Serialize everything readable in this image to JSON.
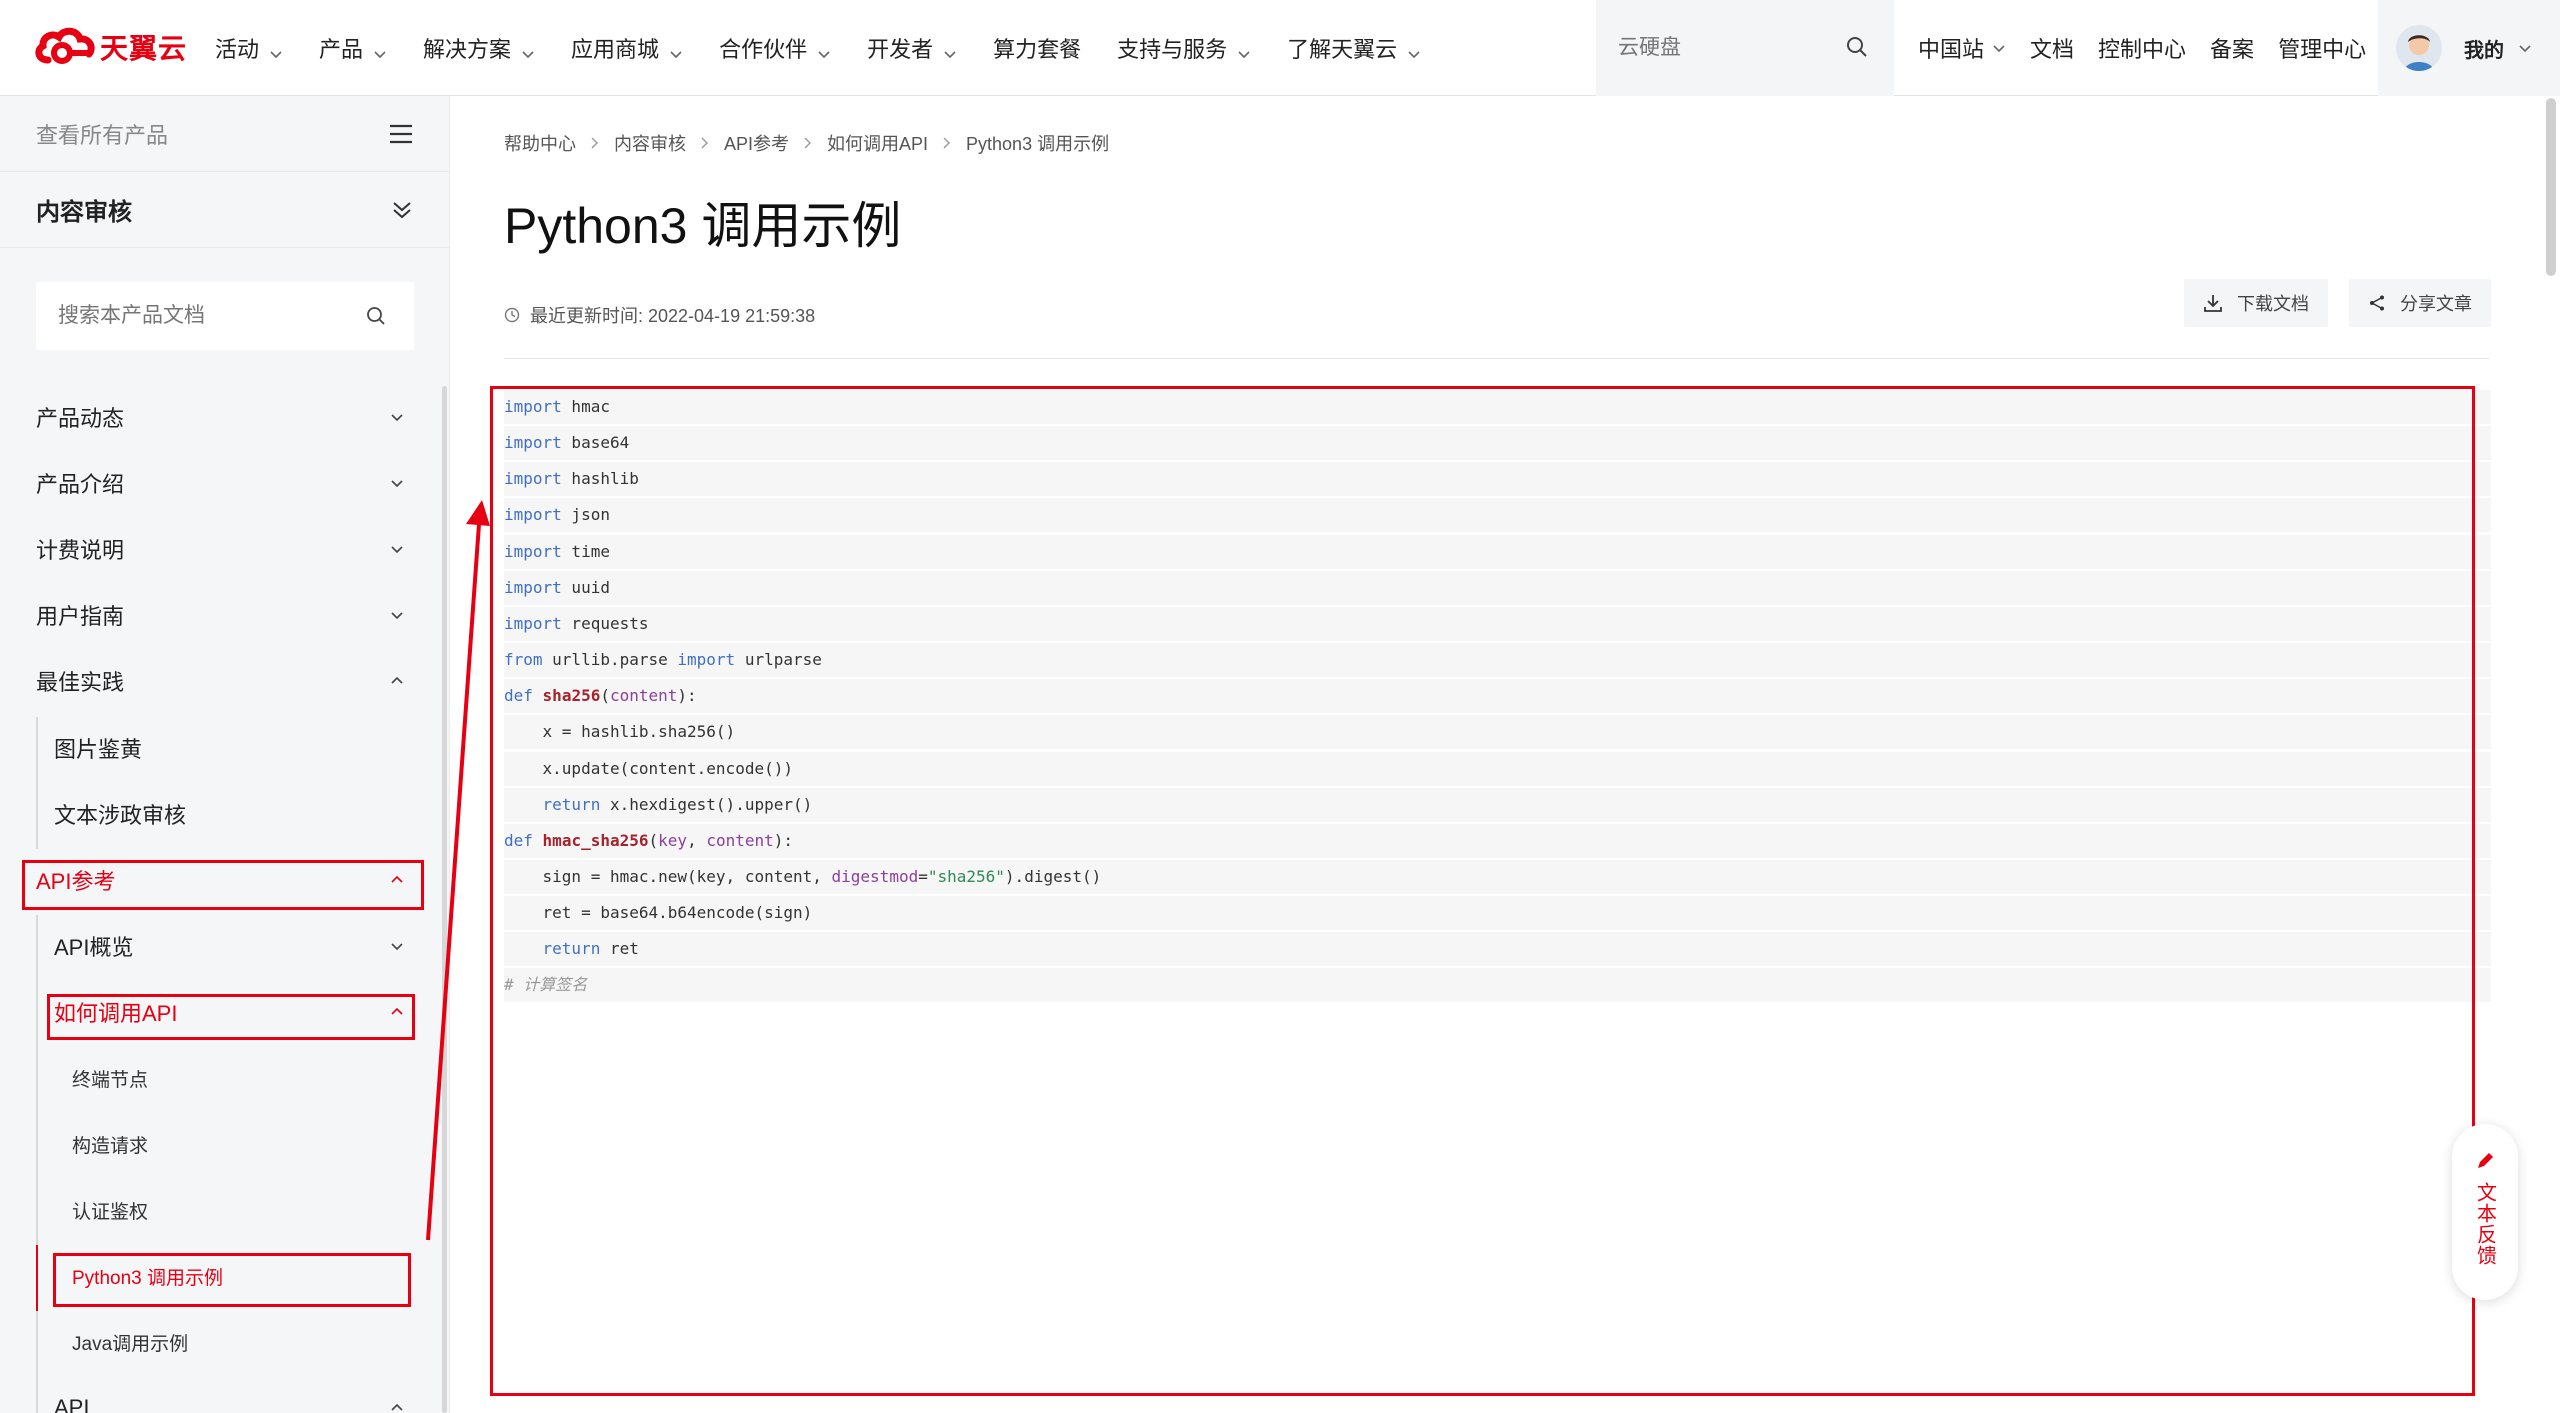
{
  "brand": {
    "name": "天翼云",
    "color": "#e60012"
  },
  "nav": {
    "items": [
      {
        "label": "活动",
        "dropdown": true
      },
      {
        "label": "产品",
        "dropdown": true
      },
      {
        "label": "解决方案",
        "dropdown": true
      },
      {
        "label": "应用商城",
        "dropdown": true
      },
      {
        "label": "合作伙伴",
        "dropdown": true
      },
      {
        "label": "开发者",
        "dropdown": true
      },
      {
        "label": "算力套餐",
        "dropdown": false
      },
      {
        "label": "支持与服务",
        "dropdown": true
      },
      {
        "label": "了解天翼云",
        "dropdown": true
      }
    ],
    "search_placeholder": "云硬盘",
    "right_links": [
      {
        "label": "中国站",
        "dropdown": true
      },
      {
        "label": "文档",
        "dropdown": false
      },
      {
        "label": "控制中心",
        "dropdown": false
      },
      {
        "label": "备案",
        "dropdown": false
      },
      {
        "label": "管理中心",
        "dropdown": false
      }
    ],
    "user_label": "我的"
  },
  "sidebar": {
    "all_products": "查看所有产品",
    "product_name": "内容审核",
    "search_placeholder": "搜索本产品文档",
    "menu": [
      {
        "label": "产品动态",
        "level": 0,
        "state": "collapsed"
      },
      {
        "label": "产品介绍",
        "level": 0,
        "state": "collapsed"
      },
      {
        "label": "计费说明",
        "level": 0,
        "state": "collapsed"
      },
      {
        "label": "用户指南",
        "level": 0,
        "state": "collapsed"
      },
      {
        "label": "最佳实践",
        "level": 0,
        "state": "expanded"
      },
      {
        "label": "图片鉴黄",
        "level": 1,
        "state": "none"
      },
      {
        "label": "文本涉政审核",
        "level": 1,
        "state": "none"
      },
      {
        "label": "API参考",
        "level": 0,
        "state": "expanded",
        "active": true
      },
      {
        "label": "API概览",
        "level": 1,
        "state": "collapsed"
      },
      {
        "label": "如何调用API",
        "level": 1,
        "state": "expanded",
        "active": true
      },
      {
        "label": "终端节点",
        "level": 2,
        "state": "none"
      },
      {
        "label": "构造请求",
        "level": 2,
        "state": "none"
      },
      {
        "label": "认证鉴权",
        "level": 2,
        "state": "none"
      },
      {
        "label": "Python3 调用示例",
        "level": 2,
        "state": "none",
        "active": true
      },
      {
        "label": "Java调用示例",
        "level": 2,
        "state": "none"
      },
      {
        "label": "API",
        "level": 1,
        "state": "expanded"
      }
    ]
  },
  "main": {
    "breadcrumb": [
      "帮助中心",
      "内容审核",
      "API参考",
      "如何调用API",
      "Python3 调用示例"
    ],
    "title": "Python3 调用示例",
    "updated": "最近更新时间: 2022-04-19 21:59:38",
    "download_label": "下载文档",
    "share_label": "分享文章",
    "code_lines": [
      "import hmac",
      "import base64",
      "import hashlib",
      "import json",
      "import time",
      "import uuid",
      "import requests",
      "from urllib.parse import urlparse",
      "def sha256(content):",
      "    x = hashlib.sha256()",
      "    x.update(content.encode())",
      "    return x.hexdigest().upper()",
      "def hmac_sha256(key, content):",
      "    sign = hmac.new(key, content, digestmod=\"sha256\").digest()",
      "    ret = base64.b64encode(sign)",
      "    return ret",
      "# 计算签名"
    ]
  },
  "feedback_label": "文本反馈",
  "colors": {
    "accent": "#e60012",
    "keyword": "#3f6fc4",
    "function": "#a8222b"
  }
}
